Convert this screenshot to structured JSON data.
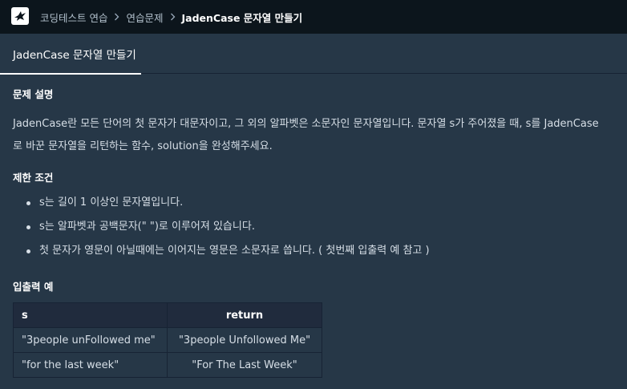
{
  "header": {
    "logo_icon": "programmers-logo-icon",
    "breadcrumbs": [
      "코딩테스트 연습",
      "연습문제"
    ],
    "current": "JadenCase 문자열 만들기"
  },
  "tab": {
    "label": "JadenCase 문자열 만들기"
  },
  "problem": {
    "description_title": "문제 설명",
    "description": "JadenCase란 모든 단어의 첫 문자가 대문자이고, 그 외의 알파벳은 소문자인 문자열입니다. 문자열 s가 주어졌을 때, s를 JadenCase로 바꾼 문자열을 리턴하는 함수, solution을 완성해주세요.",
    "constraints_title": "제한 조건",
    "constraints": [
      "s는 길이 1 이상인 문자열입니다.",
      "s는 알파벳과 공백문자(\" \")로 이루어져 있습니다.",
      "첫 문자가 영문이 아닐때에는 이어지는 영문은 소문자로 씁니다. ( 첫번째 입출력 예 참고 )"
    ],
    "examples_title": "입출력 예",
    "examples": {
      "headers": [
        "s",
        "return"
      ],
      "rows": [
        [
          "\"3people unFollowed me\"",
          "\"3people Unfollowed Me\""
        ],
        [
          "\"for the last week\"",
          "\"For The Last Week\""
        ]
      ]
    }
  },
  "colors": {
    "topbar": "#0c151c",
    "background": "#263747",
    "table_header": "#202b3d",
    "text": "#d7dfe7"
  }
}
